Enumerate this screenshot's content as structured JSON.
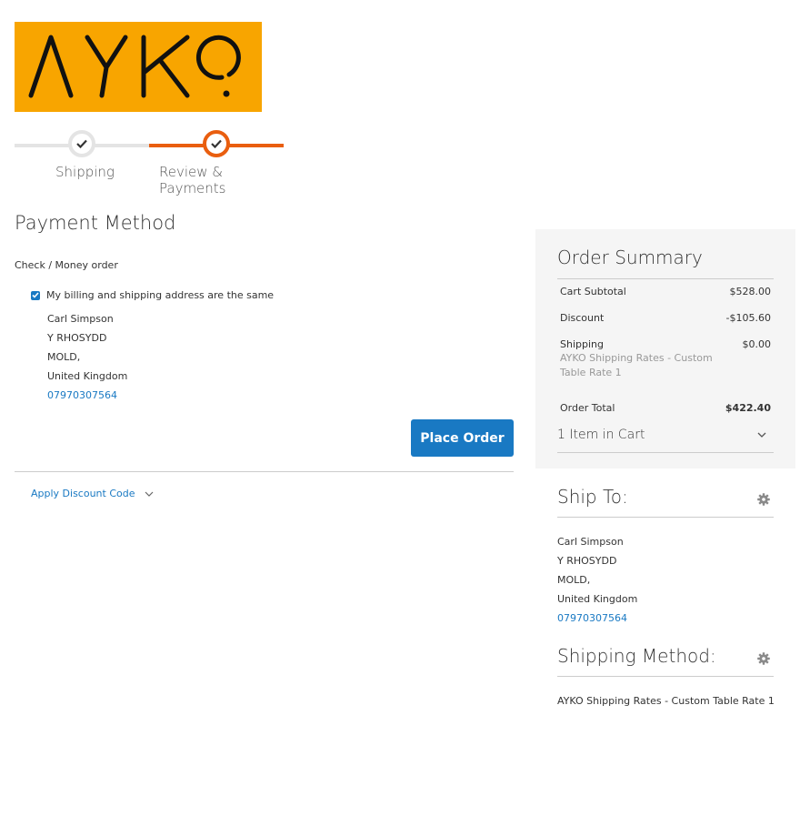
{
  "brand": {
    "logo_text": "AYKO",
    "logo_bg": "#f8a500"
  },
  "progress": {
    "steps": [
      {
        "label": "Shipping",
        "status": "complete"
      },
      {
        "label": "Review & Payments",
        "status": "active"
      }
    ],
    "active_color": "#e95e0f"
  },
  "payment": {
    "title": "Payment Method",
    "option": "Check / Money order",
    "billing_same_label": "My billing and shipping address are the same",
    "billing_same_checked": true,
    "address": {
      "name": "Carl Simpson",
      "line1": "Y RHOSYDD",
      "city": "MOLD,",
      "country": "United Kingdom",
      "phone": "07970307564"
    },
    "place_order_label": "Place Order",
    "discount_label": "Apply Discount Code"
  },
  "summary": {
    "title": "Order Summary",
    "rows": {
      "subtotal": {
        "label": "Cart Subtotal",
        "amount": "$528.00"
      },
      "discount": {
        "label": "Discount",
        "amount": "-$105.60"
      },
      "shipping": {
        "label": "Shipping",
        "detail": "AYKO Shipping Rates - Custom Table Rate 1",
        "amount": "$0.00"
      },
      "total": {
        "label": "Order Total",
        "amount": "$422.40"
      }
    },
    "items_in_cart": "1 Item in Cart"
  },
  "ship_to": {
    "title": "Ship To:",
    "address": {
      "name": "Carl Simpson",
      "line1": "Y RHOSYDD",
      "city": "MOLD,",
      "country": "United Kingdom",
      "phone": "07970307564"
    }
  },
  "shipping_method": {
    "title": "Shipping Method:",
    "value": "AYKO Shipping Rates - Custom Table Rate 1"
  },
  "colors": {
    "link": "#1979c3",
    "button": "#1979c3",
    "summary_bg": "#f5f5f5"
  },
  "icons": [
    "checkmark-icon",
    "checkbox-icon",
    "chevron-down-icon",
    "gear-icon"
  ]
}
